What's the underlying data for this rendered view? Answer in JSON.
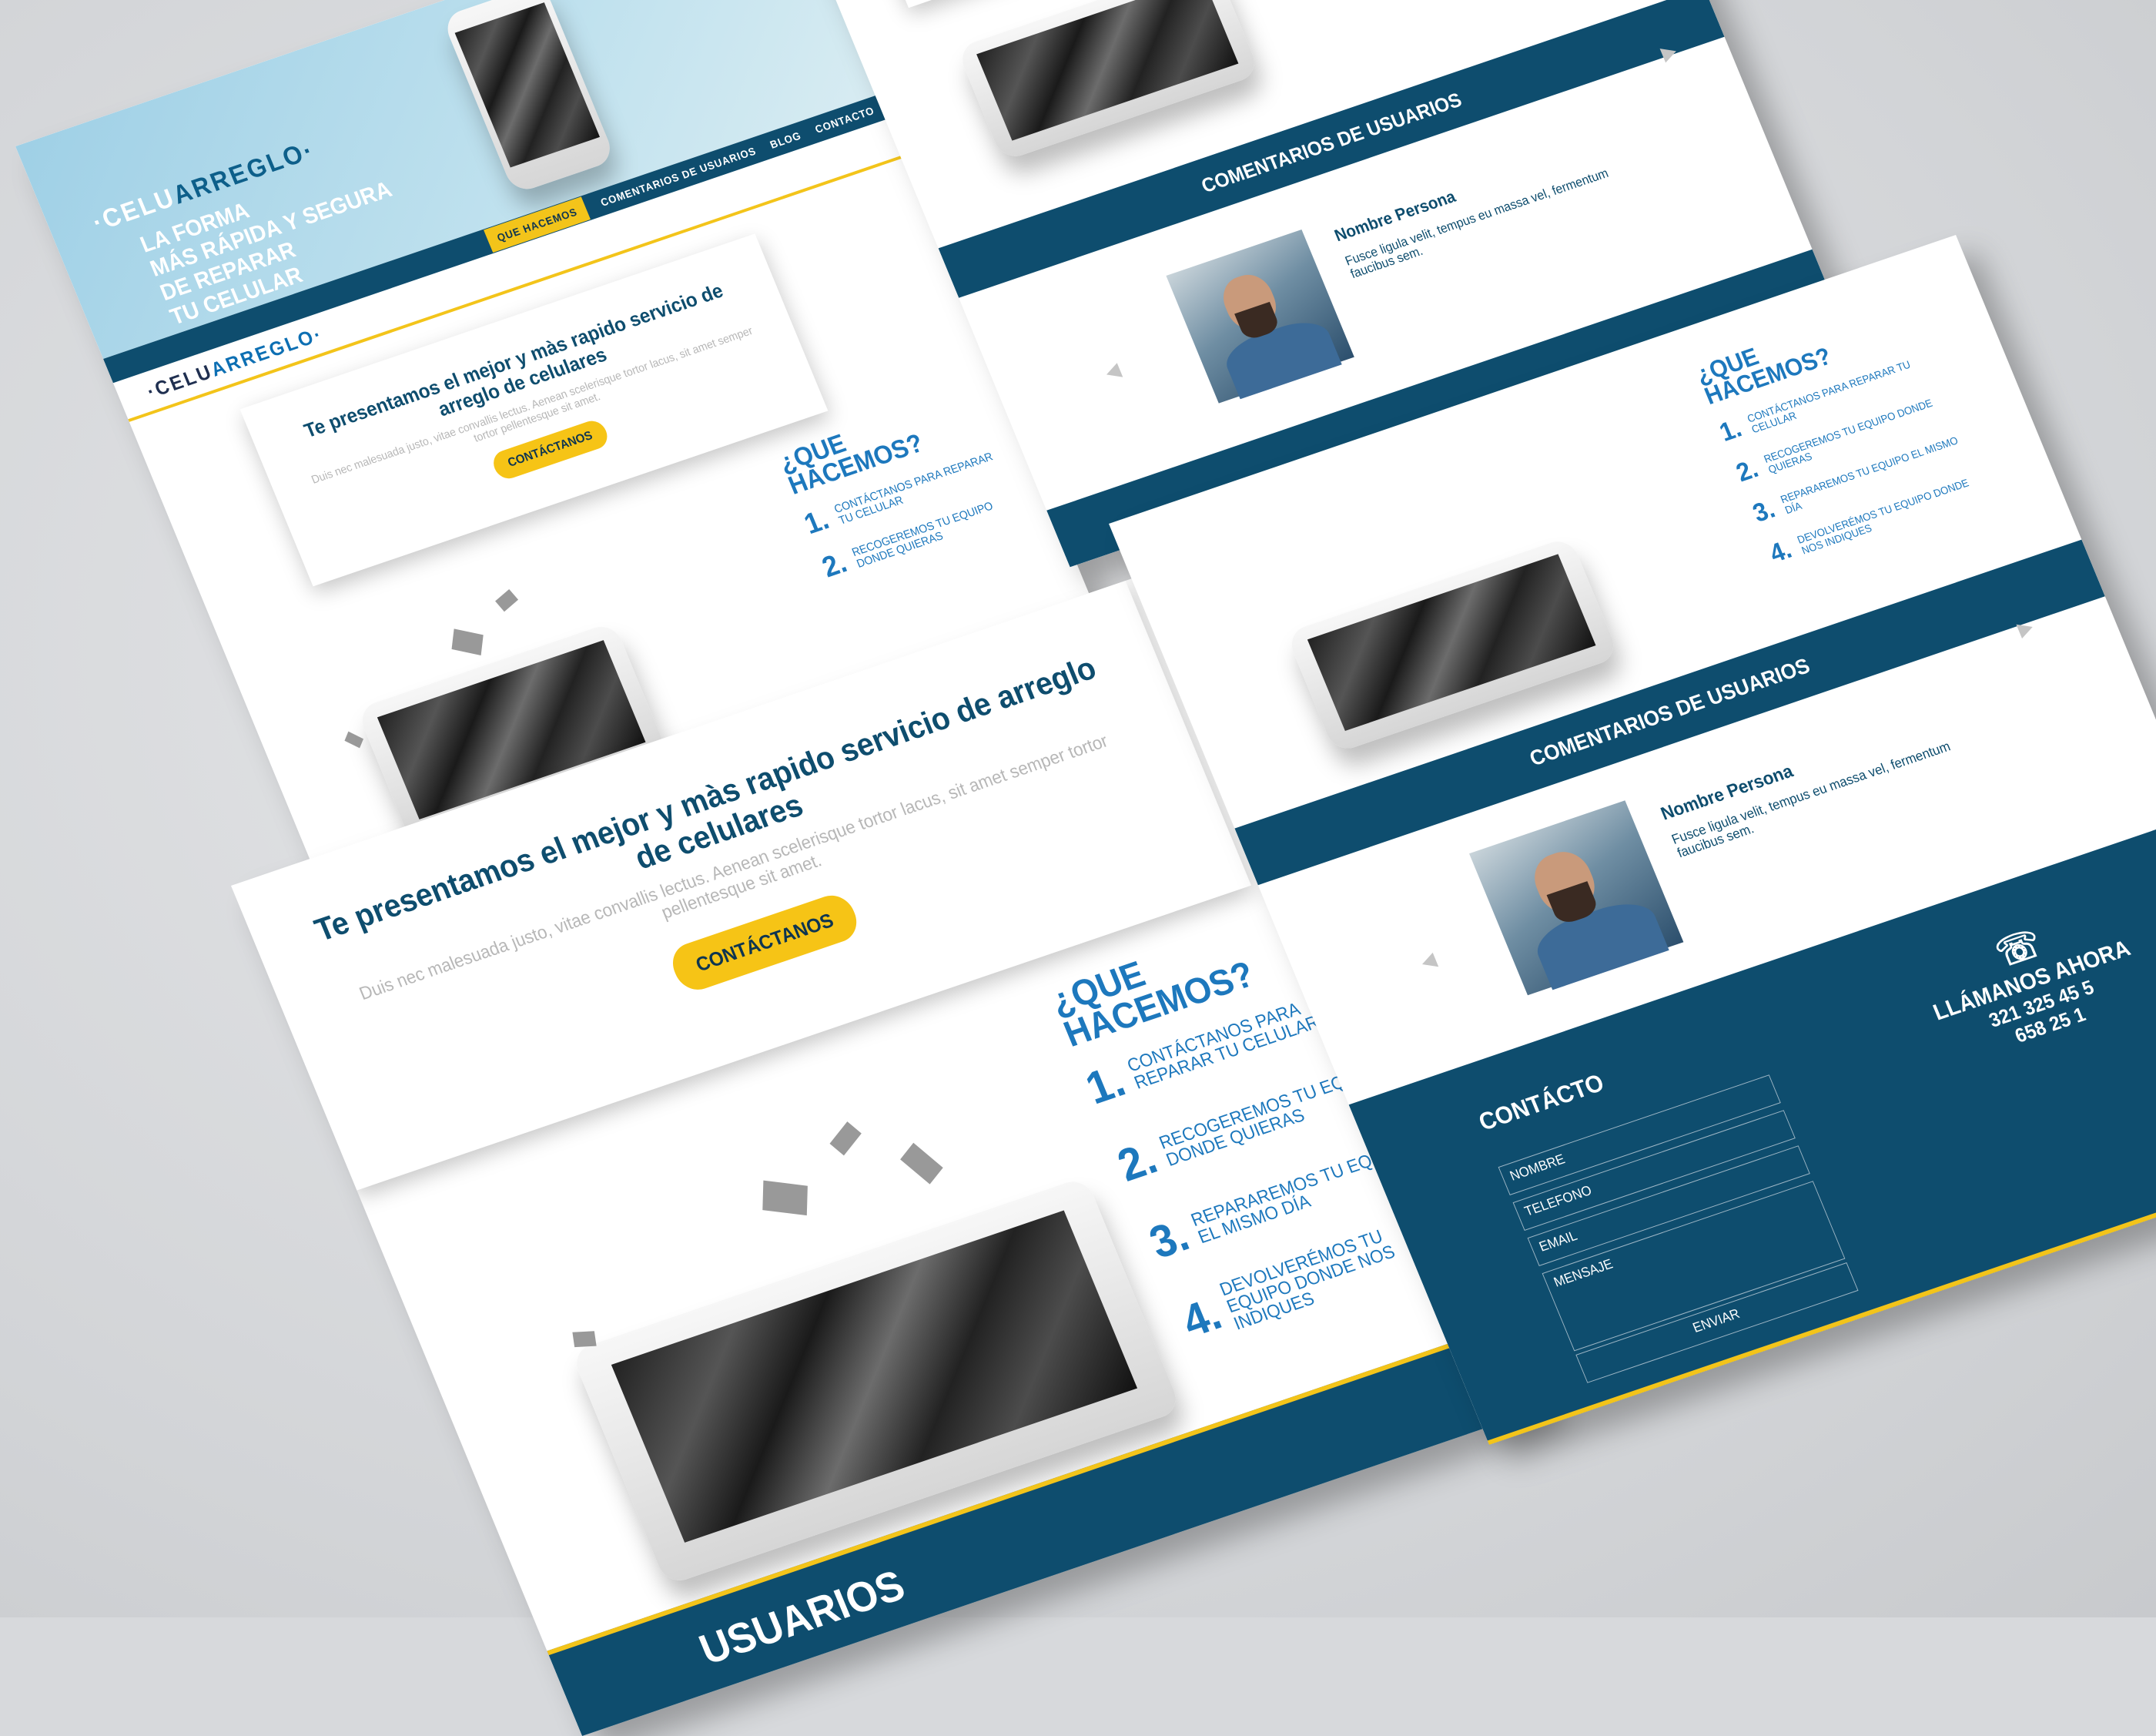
{
  "brand": {
    "logo_a": "·CELU",
    "logo_b": "ARREGLO·"
  },
  "hero": {
    "tagline": [
      "LA FORMA",
      "MÁS RÁPIDA Y SEGURA",
      "DE REPARAR",
      "TU CELULAR"
    ]
  },
  "nav": {
    "items": [
      "QUE HACEMOS",
      "COMENTARIOS DE USUARIOS",
      "BLOG",
      "CONTACTO"
    ]
  },
  "intro": {
    "title": "Te presentamos el mejor y màs rapido servicio de arreglo de celulares",
    "body": "Duis nec malesuada justo, vitae convallis lectus. Aenean scelerisque tortor lacus, sit amet semper tortor pellentesque sit amet.",
    "button": "CONTÁCTANOS"
  },
  "que": {
    "title_1": "¿QUE",
    "title_2": "HACEMOS?",
    "steps": [
      {
        "num": "1.",
        "text": "CONTÁCTANOS PARA REPARAR TU CELULAR"
      },
      {
        "num": "2.",
        "text": "RECOGEREMOS TU EQUIPO DONDE QUIERAS"
      },
      {
        "num": "3.",
        "text": "REPARAREMOS TU EQUIPO EL MISMO DÍA"
      },
      {
        "num": "4.",
        "text": "DEVOLVERÉMOS TU EQUIPO DONDE NOS INDIQUES"
      }
    ]
  },
  "comments": {
    "title": "COMENTARIOS DE USUARIOS",
    "name": "Nombre Persona",
    "text": "Fusce ligula velit, tempus eu massa vel, fermentum faucibus sem."
  },
  "contact": {
    "title": "CONTÁCTO",
    "fields": [
      "NOMBRE",
      "TELEFONO",
      "EMAIL",
      "MENSAJE"
    ],
    "submit": "ENVIAR",
    "call_label": "LLÁMANOS AHORA",
    "phone_1": "321 325 45 5",
    "phone_2": "658 25 1",
    "phone_icon": "phone-icon"
  },
  "bottom_band": {
    "text": "USUARIOS"
  },
  "colors": {
    "navy": "#0e4d6e",
    "yellow": "#f3c41a",
    "blue": "#1d78bd"
  }
}
